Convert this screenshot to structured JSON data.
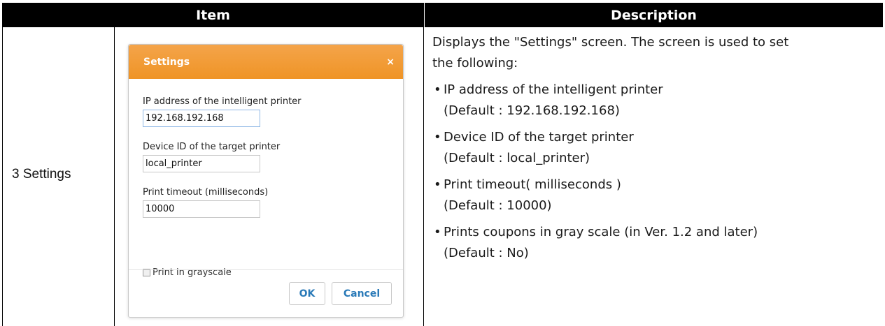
{
  "table": {
    "header_item": "Item",
    "header_description": "Description",
    "row_label": "3 Settings"
  },
  "dialog": {
    "title": "Settings",
    "close_glyph": "×",
    "fields": [
      {
        "label": "IP address of the intelligent printer",
        "value": "192.168.192.168"
      },
      {
        "label": "Device ID of the target printer",
        "value": "local_printer"
      },
      {
        "label": "Print timeout (milliseconds)",
        "value": "10000"
      }
    ],
    "checkbox_label": "Print in grayscale",
    "checkbox_checked": false,
    "ok_label": "OK",
    "cancel_label": "Cancel"
  },
  "description": {
    "intro_line1": "Displays the \"Settings\" screen. The screen is used to set",
    "intro_line2": "the following:",
    "bullets": [
      {
        "text": "IP address of the intelligent printer",
        "default": "(Default : 192.168.192.168)"
      },
      {
        "text": "Device ID of the target printer",
        "default": "(Default : local_printer)"
      },
      {
        "text": "Print timeout( milliseconds )",
        "default": "(Default : 10000)"
      },
      {
        "text": "Prints coupons in gray scale (in Ver. 1.2 and later)",
        "default": "(Default : No)"
      }
    ],
    "bullet_glyph": "•"
  },
  "colors": {
    "header_bg": "#000000",
    "dialog_title_bg": "#f09a30",
    "button_text": "#2a7ab8"
  }
}
